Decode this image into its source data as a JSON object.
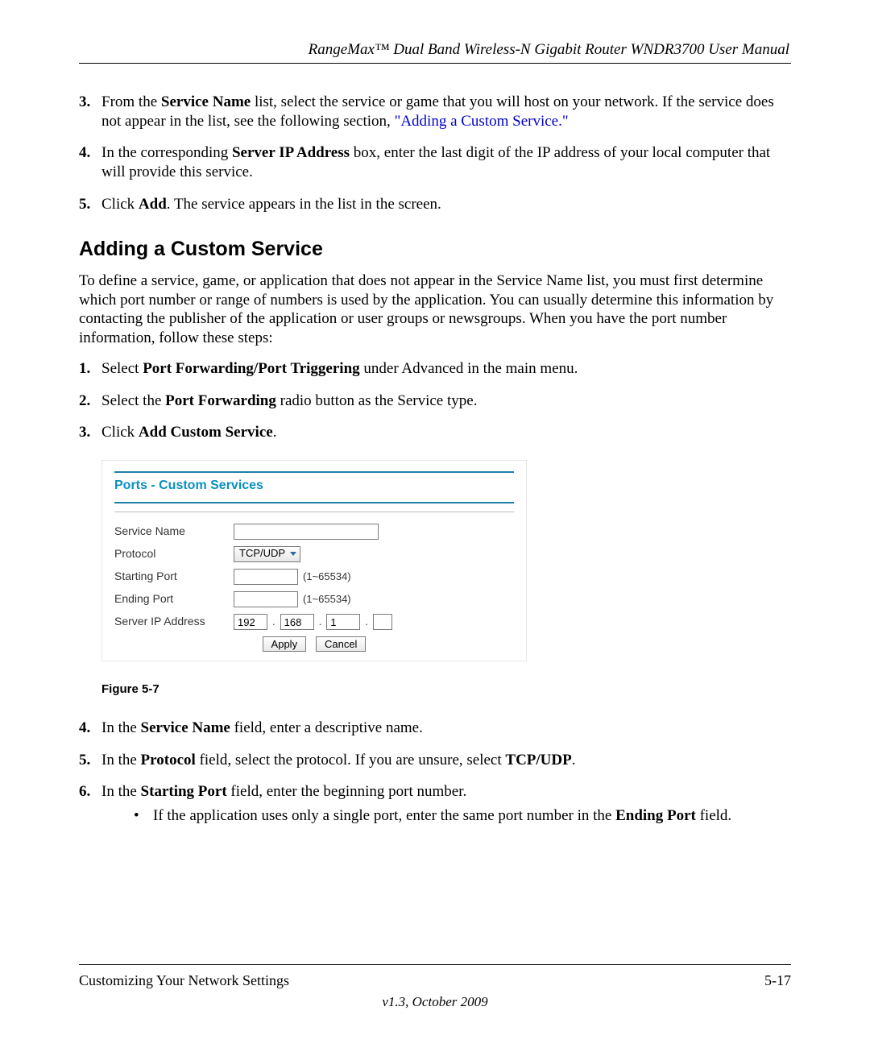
{
  "header": {
    "running_head": "RangeMax™ Dual Band Wireless-N Gigabit Router WNDR3700 User Manual"
  },
  "initial_steps": {
    "item3": {
      "num": "3.",
      "pre": "From the ",
      "bold1": "Service Name",
      "mid": " list, select the service or game that you will host on your network. If the service does not appear in the list, see the following section, ",
      "link": "\"Adding a Custom Service.\""
    },
    "item4": {
      "num": "4.",
      "pre": "In the corresponding ",
      "bold1": "Server IP Address",
      "post": " box, enter the last digit of the IP address of your local computer that will provide this service."
    },
    "item5": {
      "num": "5.",
      "pre": "Click ",
      "bold1": "Add",
      "post": ". The service appears in the list in the screen."
    }
  },
  "section": {
    "title": "Adding a Custom Service",
    "paragraph": "To define a service, game, or application that does not appear in the Service Name list, you must first determine which port number or range of numbers is used by the application. You can usually determine this information by contacting the publisher of the application or user groups or newsgroups. When you have the port number information, follow these steps:"
  },
  "numbered_after": {
    "s1": {
      "num": "1.",
      "pre": "Select ",
      "bold": "Port Forwarding/Port Triggering",
      "post": " under Advanced in the main menu."
    },
    "s2": {
      "num": "2.",
      "pre": "Select the ",
      "bold": "Port Forwarding",
      "post": " radio button as the Service type."
    },
    "s3": {
      "num": "3.",
      "pre": "Click ",
      "bold": "Add Custom Service",
      "post": "."
    },
    "s4": {
      "num": "4.",
      "pre": "In the ",
      "bold": "Service Name",
      "post": " field, enter a descriptive name."
    },
    "s5": {
      "num": "5.",
      "pre": "In the ",
      "bold": "Protocol",
      "mid": " field, select the protocol. If you are unsure, select ",
      "bold2": "TCP/UDP",
      "post": "."
    },
    "s6": {
      "num": "6.",
      "pre": "In the ",
      "bold": "Starting Port",
      "post": " field, enter the beginning port number."
    },
    "s6_bullet": {
      "pre": "If the application uses only a single port, enter the same port number in the ",
      "bold": "Ending Port",
      "post": " field."
    }
  },
  "screenshot": {
    "panel_title": "Ports - Custom Services",
    "labels": {
      "service_name": "Service Name",
      "protocol": "Protocol",
      "starting_port": "Starting Port",
      "ending_port": "Ending Port",
      "server_ip": "Server IP Address"
    },
    "values": {
      "service_name": "",
      "protocol": "TCP/UDP",
      "starting_port": "",
      "ending_port": "",
      "ip1": "192",
      "ip2": "168",
      "ip3": "1",
      "ip4": ""
    },
    "hints": {
      "port_range": "(1~65534)"
    },
    "buttons": {
      "apply": "Apply",
      "cancel": "Cancel"
    }
  },
  "figure_caption": "Figure 5-7",
  "footer": {
    "left": "Customizing Your Network Settings",
    "right": "5-17",
    "version": "v1.3, October 2009"
  }
}
